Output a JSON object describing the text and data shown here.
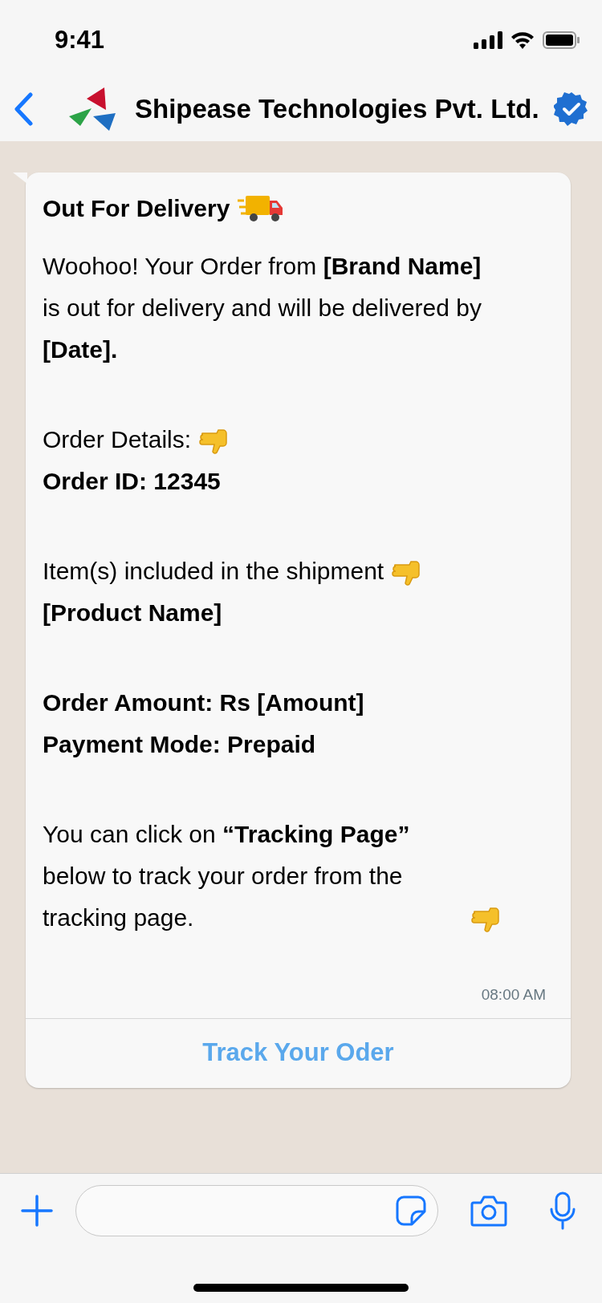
{
  "status_bar": {
    "time": "9:41"
  },
  "header": {
    "title": "Shipease Technologies Pvt. Ltd.",
    "verified": true
  },
  "message": {
    "title": "Out For Delivery",
    "sections": [
      [
        {
          "kind": "plain",
          "text": "Woohoo! Your Order from **[Brand Name]** is out for delivery and will be delivered by **[Date].**"
        }
      ],
      [
        {
          "kind": "pointer",
          "text": "Order Details:"
        },
        {
          "kind": "bold",
          "text": "Order ID: 12345"
        }
      ],
      [
        {
          "kind": "pointer",
          "text": "Item(s) included in the shipment"
        },
        {
          "kind": "bold",
          "text": "[Product Name]"
        }
      ],
      [
        {
          "kind": "bold",
          "text": "Order Amount: Rs [Amount]"
        },
        {
          "kind": "bold",
          "text": "Payment Mode: Prepaid"
        }
      ],
      [
        {
          "kind": "pointer",
          "text": "You can click on **“Tracking Page”** below to track your order from the tracking page."
        }
      ]
    ],
    "time": "08:00 AM",
    "button": "Track Your Oder"
  }
}
